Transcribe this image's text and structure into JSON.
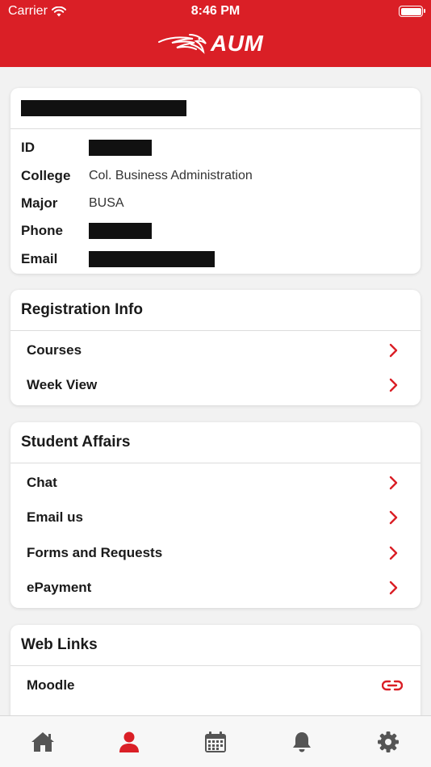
{
  "status": {
    "carrier": "Carrier",
    "time": "8:46 PM"
  },
  "header": {
    "logo_text": "AUM"
  },
  "profile": {
    "rows": [
      {
        "label": "ID",
        "value": ""
      },
      {
        "label": "College",
        "value": "Col. Business Administration"
      },
      {
        "label": "Major",
        "value": "BUSA"
      },
      {
        "label": "Phone",
        "value": ""
      },
      {
        "label": "Email",
        "value": ""
      }
    ]
  },
  "registration": {
    "title": "Registration Info",
    "items": [
      {
        "label": "Courses"
      },
      {
        "label": "Week View"
      }
    ]
  },
  "student_affairs": {
    "title": "Student Affairs",
    "items": [
      {
        "label": "Chat"
      },
      {
        "label": "Email us"
      },
      {
        "label": "Forms and Requests"
      },
      {
        "label": "ePayment"
      }
    ]
  },
  "web_links": {
    "title": "Web Links",
    "items": [
      {
        "label": "Moodle"
      }
    ]
  },
  "colors": {
    "brand_red": "#da1f26",
    "tab_active": "#da1f26",
    "tab_inactive": "#555555"
  },
  "tabs": [
    {
      "icon": "home-icon"
    },
    {
      "icon": "profile-icon"
    },
    {
      "icon": "calendar-icon"
    },
    {
      "icon": "bell-icon"
    },
    {
      "icon": "gear-icon"
    }
  ]
}
